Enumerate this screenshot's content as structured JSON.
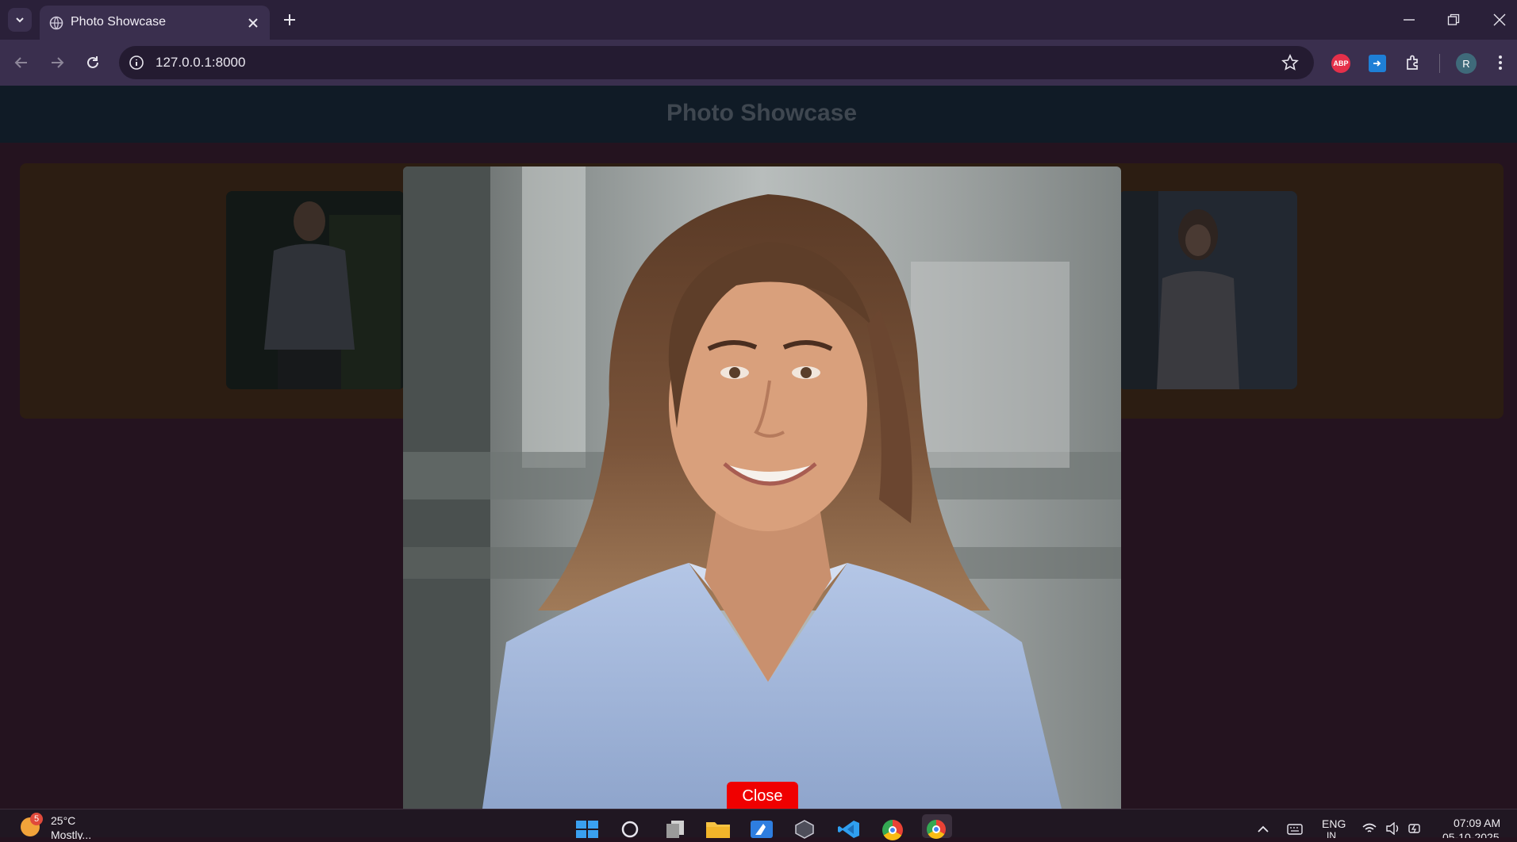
{
  "browser": {
    "tab_title": "Photo Showcase",
    "url": "127.0.0.1:8000",
    "extension_badge": "ABP",
    "profile_initial": "R"
  },
  "page": {
    "header_title": "Photo Showcase",
    "close_label": "Close"
  },
  "taskbar": {
    "weather_temp": "25°C",
    "weather_desc": "Mostly...",
    "notification_count": "5",
    "language": "ENG",
    "language_sub": "IN",
    "time": "07:09 AM",
    "date": "05-10-2025"
  },
  "colors": {
    "header_bg": "#101b26",
    "gallery_bg": "#2c1d12",
    "close_button": "#f00000",
    "page_bg": "#24131f"
  }
}
